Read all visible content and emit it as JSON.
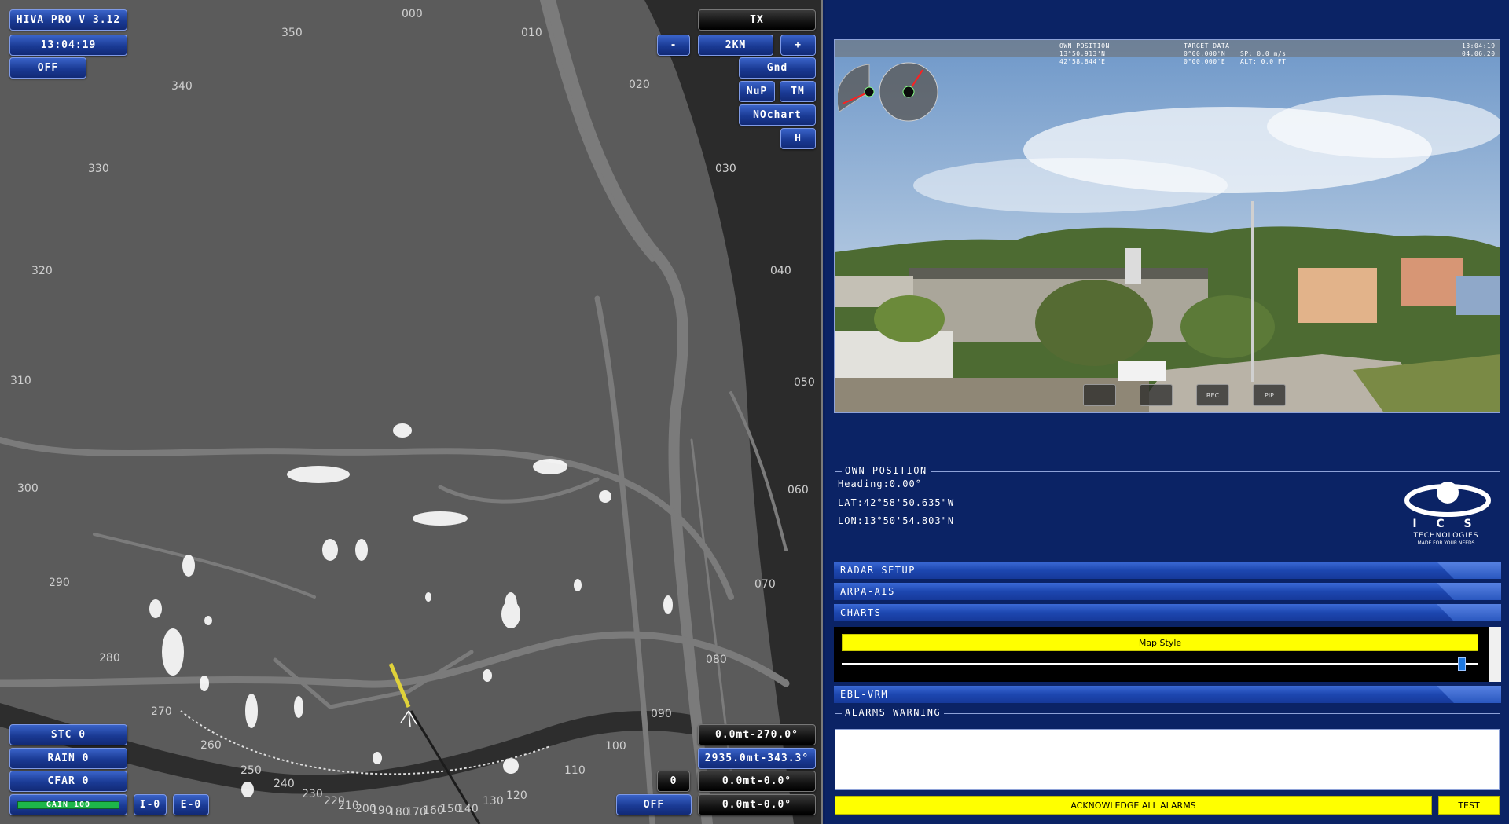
{
  "radar": {
    "title_label": "HIVA PRO V 3.12",
    "clock": "13:04:19",
    "off_top_label": "OFF",
    "tx_label": "TX",
    "range_minus": "-",
    "range_label": "2KM",
    "range_plus": "+",
    "gnd_label": "Gnd",
    "nup_label": "NuP",
    "tm_label": "TM",
    "nochart_label": "NOchart",
    "h_label": "H",
    "stc_label": "STC 0",
    "rain_label": "RAIN 0",
    "cfar_label": "CFAR 0",
    "gain_label": "GAIN 100",
    "io_label": "I-0",
    "eo_label": "E-0",
    "off_bottom_label": "OFF",
    "zero_label": "0",
    "readout1": "0.0mt-270.0°",
    "readout2": "2935.0mt-343.3°",
    "readout3": "0.0mt-0.0°",
    "readout4": "0.0mt-0.0°",
    "bearings": [
      "000",
      "010",
      "020",
      "030",
      "040",
      "050",
      "060",
      "070",
      "080",
      "090",
      "100",
      "110",
      "120",
      "130",
      "140",
      "150",
      "160",
      "170",
      "180",
      "190",
      "200",
      "210",
      "220",
      "230",
      "240",
      "250",
      "260",
      "270",
      "280",
      "290",
      "300",
      "310",
      "320",
      "330",
      "340",
      "350"
    ],
    "colors": {
      "background": "#5b5b5b",
      "sea": "#2b2b2b",
      "button": "#1a3a94",
      "sweep": "#e0d23a"
    }
  },
  "camera": {
    "own_position_label": "OWN POSITION",
    "own_lat": "13°50.913'N",
    "own_lon": "42°58.844'E",
    "target_label": "TARGET DATA",
    "target_lat": "0°00.000'N",
    "target_lon": "0°00.000'E",
    "target_sp": "SP: 0.0 m/s",
    "target_alt": "ALT: 0.0 FT",
    "time": "13:04:19",
    "date": "04.06.20",
    "buttons": [
      "",
      "",
      "REC",
      "PIP"
    ]
  },
  "own_position": {
    "title": "OWN POSITION",
    "heading": "Heading:0.00°",
    "lat": "LAT:42°58'50.635\"W",
    "lon": "LON:13°50'54.803\"N",
    "logo_letters": "I C S",
    "logo_name": "TECHNOLOGIES",
    "logo_tagline": "MADE FOR YOUR NEEDS"
  },
  "sections": {
    "radar_setup": "RADAR SETUP",
    "arpa_ais": "ARPA-AIS",
    "charts": "CHARTS",
    "ebl_vrm": "EBL-VRM"
  },
  "charts": {
    "map_style_label": "Map Style",
    "slider_value": 0.98
  },
  "alarms": {
    "title": "ALARMS WARNING",
    "ack_label": "ACKNOWLEDGE ALL ALARMS",
    "test_label": "TEST"
  }
}
